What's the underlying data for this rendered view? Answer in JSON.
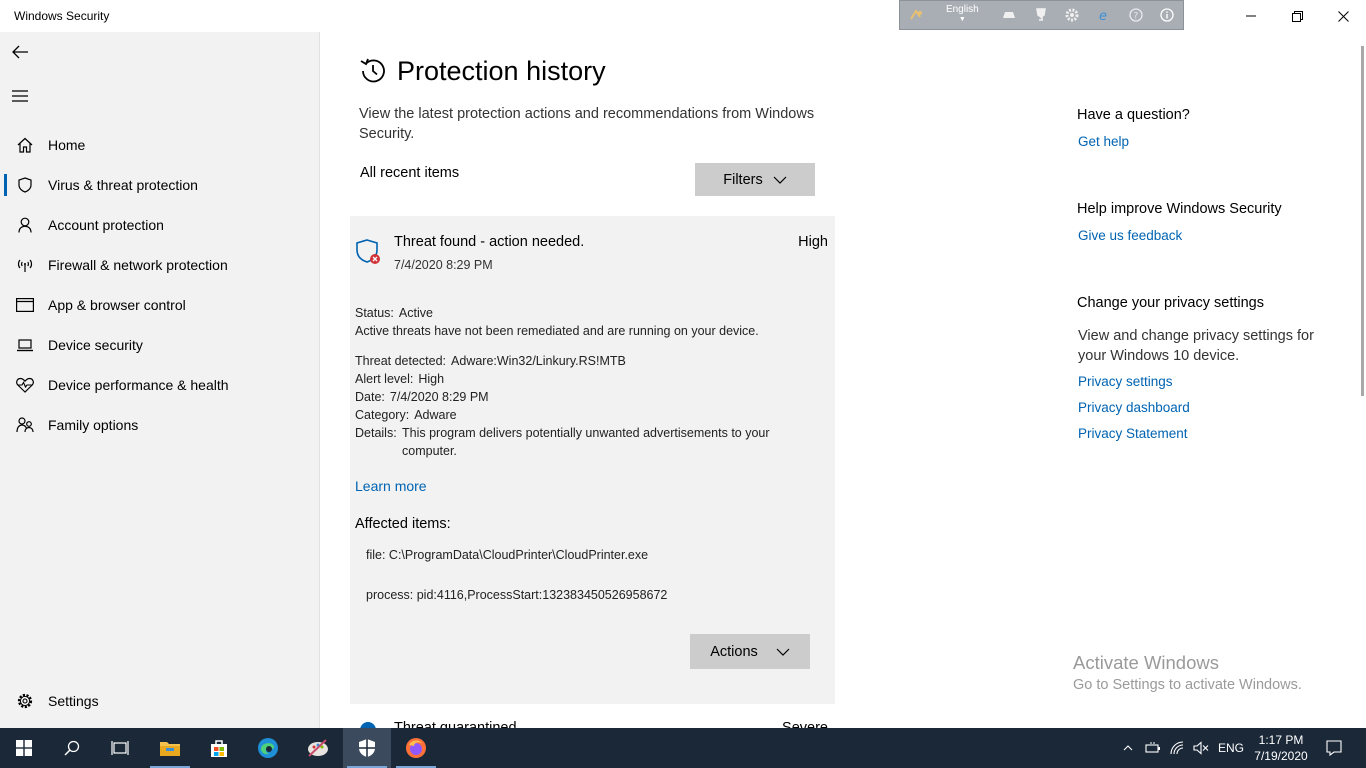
{
  "window": {
    "title": "Windows Security",
    "language_bar": {
      "language": "English"
    }
  },
  "sidebar": {
    "items": [
      {
        "label": "Home",
        "icon": "home-icon"
      },
      {
        "label": "Virus & threat protection",
        "icon": "shield-icon",
        "active": true
      },
      {
        "label": "Account protection",
        "icon": "person-icon"
      },
      {
        "label": "Firewall & network protection",
        "icon": "antenna-icon"
      },
      {
        "label": "App & browser control",
        "icon": "browser-window-icon"
      },
      {
        "label": "Device security",
        "icon": "laptop-icon"
      },
      {
        "label": "Device performance & health",
        "icon": "heart-pulse-icon"
      },
      {
        "label": "Family options",
        "icon": "family-icon"
      }
    ],
    "settings_label": "Settings"
  },
  "main": {
    "title": "Protection history",
    "description": "View the latest protection actions and recommendations from Windows Security.",
    "section_title": "All recent items",
    "filters_label": "Filters",
    "threat": {
      "title": "Threat found - action needed.",
      "date": "7/4/2020 8:29 PM",
      "severity": "High",
      "status_label": "Status:",
      "status_value": "Active",
      "status_desc": "Active threats have not been remediated and are running on your device.",
      "detected_label": "Threat detected:",
      "detected_value": "Adware:Win32/Linkury.RS!MTB",
      "alert_label": "Alert level:",
      "alert_value": "High",
      "date_label": "Date:",
      "date_value": "7/4/2020 8:29 PM",
      "category_label": "Category:",
      "category_value": "Adware",
      "details_label": "Details:",
      "details_value": "This program delivers potentially unwanted advertisements to your computer.",
      "learn_more": "Learn more",
      "affected_title": "Affected items:",
      "affected_items": [
        "file: C:\\ProgramData\\CloudPrinter\\CloudPrinter.exe",
        "process: pid:4116,ProcessStart:132383450526958672"
      ],
      "actions_label": "Actions"
    },
    "next_item": {
      "title": "Threat quarantined",
      "severity": "Severe"
    }
  },
  "right_panel": {
    "question_heading": "Have a question?",
    "get_help": "Get help",
    "improve_heading": "Help improve Windows Security",
    "feedback": "Give us feedback",
    "privacy_heading": "Change your privacy settings",
    "privacy_text": "View and change privacy settings for your Windows 10 device.",
    "privacy_links": [
      "Privacy settings",
      "Privacy dashboard",
      "Privacy Statement"
    ]
  },
  "watermark": {
    "line1": "Activate Windows",
    "line2": "Go to Settings to activate Windows."
  },
  "taskbar": {
    "language": "ENG",
    "time": "1:17 PM",
    "date": "7/19/2020"
  },
  "colors": {
    "accent": "#0063b1",
    "sidebar_bg": "#f2f2f2",
    "card_bg": "#f2f2f2",
    "button_bg": "#cccccc",
    "taskbar_bg": "#1b2838",
    "threat_red": "#d13438"
  }
}
